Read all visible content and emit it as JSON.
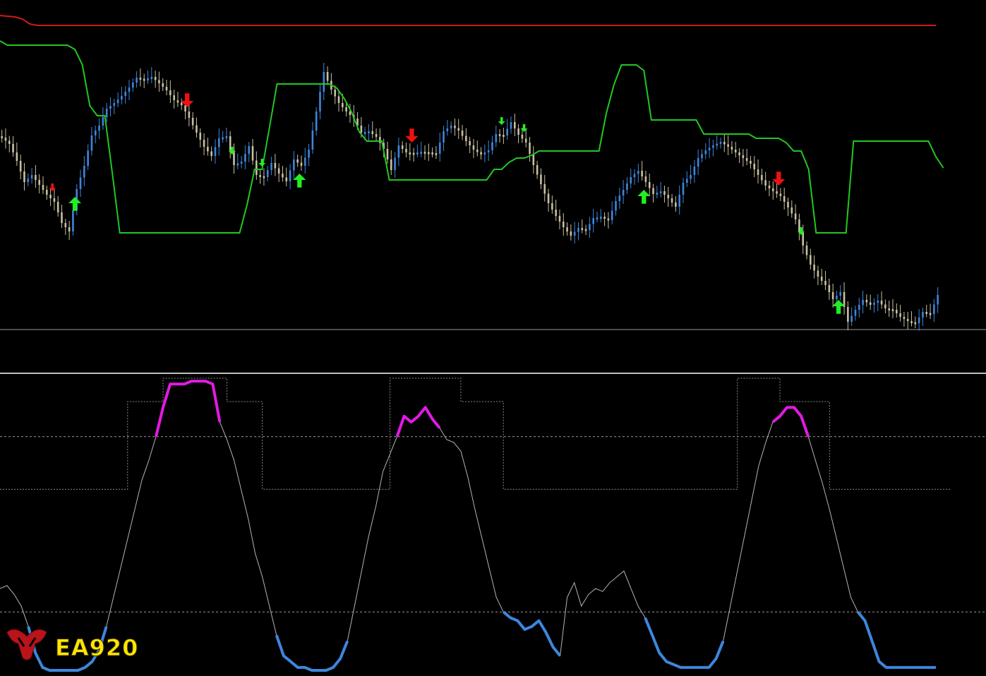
{
  "colors": {
    "background": "#000000",
    "candle_up": "#3d86dd",
    "candle_down": "#c8c0a0",
    "upper_band": "#d11a1a",
    "channel_line": "#22c722",
    "arrow_buy": "#22ee22",
    "arrow_sell": "#ee1111",
    "horizontal_level": "#9a9a9a",
    "osc_neutral": "#b4b4b4",
    "osc_overbought": "#e21ae2",
    "osc_oversold": "#3d86dd",
    "step_line": "#8a8a8a",
    "logo_text": "#ffe600",
    "logo_icon": "#d11a1a"
  },
  "logo": {
    "text": "EA920",
    "icon": "bull-head-icon"
  },
  "chart_data": [
    {
      "type": "candlestick",
      "title": "",
      "series": [
        {
          "kind": "price",
          "close": [
            195,
            204,
            228,
            258,
            248,
            262,
            276,
            286,
            316,
            328,
            268,
            235,
            192,
            178,
            154,
            146,
            136,
            124,
            110,
            113,
            109,
            118,
            128,
            142,
            149,
            167,
            188,
            208,
            221,
            196,
            193,
            234,
            229,
            207,
            248,
            251,
            231,
            246,
            257,
            226,
            235,
            212,
            158,
            102,
            127,
            146,
            158,
            168,
            188,
            186,
            194,
            211,
            241,
            206,
            216,
            217,
            215,
            216,
            218,
            186,
            178,
            185,
            200,
            212,
            219,
            213,
            190,
            192,
            173,
            191,
            202,
            234,
            261,
            288,
            306,
            322,
            334,
            323,
            326,
            309,
            307,
            312,
            285,
            269,
            251,
            242,
            258,
            275,
            271,
            281,
            293,
            259,
            248,
            224,
            213,
            206,
            201,
            208,
            216,
            224,
            232,
            248,
            263,
            271,
            278,
            294,
            311,
            348,
            375,
            392,
            404,
            424,
            414,
            456,
            439,
            425,
            432,
            426,
            437,
            439,
            449,
            455,
            458,
            442,
            445,
            418
          ]
        },
        {
          "kind": "upper_band",
          "values": [
            22,
            23,
            24,
            27,
            34,
            36,
            36,
            36,
            36,
            36,
            36,
            36,
            36,
            36,
            36,
            36,
            36,
            36,
            36,
            36,
            36,
            36,
            36,
            36,
            36,
            36,
            36,
            36,
            36,
            36,
            36,
            36,
            36,
            36,
            36,
            36,
            36,
            36,
            36,
            36,
            36,
            36,
            36,
            36,
            36,
            36,
            36,
            36,
            36,
            36,
            36,
            36,
            36,
            36,
            36,
            36,
            36,
            36,
            36,
            36,
            36,
            36,
            36,
            36,
            36,
            36,
            36,
            36,
            36,
            36,
            36,
            36,
            36,
            36,
            36,
            36,
            36,
            36,
            36,
            36,
            36,
            36,
            36,
            36,
            36,
            36,
            36,
            36,
            36,
            36,
            36,
            36,
            36,
            36,
            36,
            36,
            36,
            36,
            36,
            36,
            36,
            36,
            36,
            36,
            36,
            36,
            36,
            36,
            36,
            36,
            36,
            36,
            36,
            36,
            36,
            36,
            36,
            36,
            36,
            36,
            36,
            36,
            36,
            36,
            36,
            36
          ]
        },
        {
          "kind": "channel",
          "values": [
            58,
            64,
            64,
            64,
            64,
            64,
            64,
            64,
            64,
            64,
            70,
            92,
            150,
            164,
            164,
            245,
            330,
            330,
            330,
            330,
            330,
            330,
            330,
            330,
            330,
            330,
            330,
            330,
            330,
            330,
            330,
            330,
            330,
            290,
            240,
            240,
            180,
            119,
            119,
            119,
            119,
            119,
            119,
            119,
            119,
            125,
            140,
            160,
            187,
            200,
            200,
            200,
            255,
            255,
            255,
            255,
            255,
            255,
            255,
            255,
            255,
            255,
            255,
            255,
            255,
            255,
            240,
            240,
            230,
            224,
            224,
            220,
            214,
            214,
            214,
            214,
            214,
            214,
            214,
            214,
            214,
            160,
            120,
            92,
            92,
            92,
            100,
            170,
            170,
            170,
            170,
            170,
            170,
            170,
            190,
            190,
            190,
            190,
            190,
            190,
            190,
            196,
            196,
            196,
            196,
            202,
            214,
            214,
            240,
            330,
            330,
            330,
            330,
            330,
            200,
            200,
            200,
            200,
            200,
            200,
            200,
            200,
            200,
            200,
            200,
            222,
            238
          ]
        }
      ],
      "arrows": [
        {
          "dir": "up",
          "size": "large",
          "i": 10
        },
        {
          "dir": "down",
          "size": "small",
          "i": 7
        },
        {
          "dir": "down",
          "size": "large",
          "i": 25
        },
        {
          "dir": "down",
          "size": "small",
          "i": 31
        },
        {
          "dir": "down",
          "size": "small",
          "i": 35
        },
        {
          "dir": "up",
          "size": "large",
          "i": 40
        },
        {
          "dir": "down",
          "size": "large",
          "i": 55
        },
        {
          "dir": "down",
          "size": "small",
          "i": 67
        },
        {
          "dir": "down",
          "size": "small",
          "i": 70
        },
        {
          "dir": "up",
          "size": "large",
          "i": 86
        },
        {
          "dir": "down",
          "size": "large",
          "i": 104
        },
        {
          "dir": "down",
          "size": "small",
          "i": 107
        },
        {
          "dir": "up",
          "size": "large",
          "i": 112
        }
      ],
      "level": 467
    },
    {
      "type": "line",
      "title": "",
      "ylim": [
        0,
        100
      ],
      "levels": [
        20,
        80
      ],
      "oscillator": [
        28,
        29,
        26,
        22,
        15,
        6,
        1,
        0,
        0,
        0,
        0,
        0,
        1,
        3,
        7,
        15,
        25,
        35,
        45,
        55,
        65,
        72,
        80,
        90,
        98,
        98,
        98,
        99,
        99,
        99,
        98,
        85,
        79,
        72,
        62,
        52,
        40,
        32,
        22,
        12,
        5,
        3,
        1,
        1,
        0,
        0,
        0,
        1,
        4,
        10,
        22,
        34,
        46,
        56,
        68,
        74,
        80,
        87,
        85,
        87,
        90,
        86,
        83,
        79,
        78,
        75,
        66,
        55,
        45,
        35,
        25,
        20,
        18,
        17,
        14,
        15,
        17,
        13,
        8,
        5,
        25,
        30,
        22,
        26,
        28,
        27,
        30,
        32,
        34,
        28,
        22,
        18,
        12,
        6,
        3,
        2,
        1,
        1,
        1,
        1,
        1,
        4,
        10,
        22,
        34,
        46,
        58,
        70,
        78,
        85,
        87,
        90,
        90,
        87,
        80,
        72,
        64,
        55,
        45,
        35,
        25,
        20,
        17,
        10,
        3,
        1,
        1,
        1,
        1,
        1,
        1,
        1,
        1
      ],
      "steps": [
        62,
        62,
        62,
        62,
        62,
        62,
        62,
        62,
        62,
        62,
        62,
        62,
        62,
        62,
        62,
        62,
        62,
        62,
        92,
        92,
        92,
        92,
        92,
        100,
        100,
        100,
        100,
        100,
        100,
        100,
        100,
        100,
        92,
        92,
        92,
        92,
        92,
        62,
        62,
        62,
        62,
        62,
        62,
        62,
        62,
        62,
        62,
        62,
        62,
        62,
        62,
        62,
        62,
        62,
        62,
        100,
        100,
        100,
        100,
        100,
        100,
        100,
        100,
        100,
        100,
        92,
        92,
        92,
        92,
        92,
        92,
        62,
        62,
        62,
        62,
        62,
        62,
        62,
        62,
        62,
        62,
        62,
        62,
        62,
        62,
        62,
        62,
        62,
        62,
        62,
        62,
        62,
        62,
        62,
        62,
        62,
        62,
        62,
        62,
        62,
        62,
        62,
        62,
        62,
        100,
        100,
        100,
        100,
        100,
        100,
        92,
        92,
        92,
        92,
        92,
        92,
        92,
        62,
        62,
        62,
        62,
        62,
        62,
        62,
        62,
        62,
        62,
        62,
        62,
        62,
        62,
        62,
        62,
        62,
        62
      ]
    }
  ]
}
